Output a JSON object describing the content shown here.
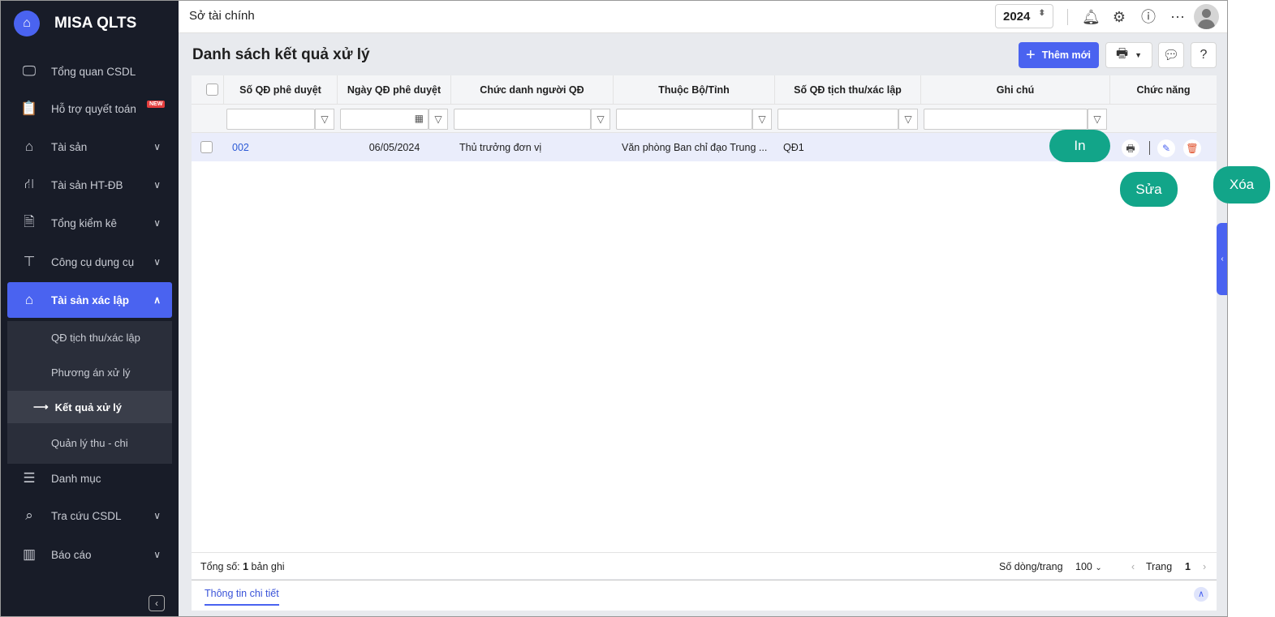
{
  "app": {
    "name": "MISA QLTS"
  },
  "sidebar": {
    "items": [
      {
        "label": "Tổng quan CSDL",
        "icon": "monitor-chart-icon"
      },
      {
        "label": "Hỗ trợ quyết toán",
        "icon": "clipboard-icon",
        "badge": "NEW"
      },
      {
        "label": "Tài sản",
        "icon": "house-car-icon"
      },
      {
        "label": "Tài sản HT-ĐB",
        "icon": "road-icon"
      },
      {
        "label": "Tổng kiểm kê",
        "icon": "document-check-icon"
      },
      {
        "label": "Công cụ dụng cụ",
        "icon": "paint-roller-icon"
      },
      {
        "label": "Tài sản xác lập",
        "icon": "house-car-icon"
      },
      {
        "label": "Danh mục",
        "icon": "list-icon"
      },
      {
        "label": "Tra cứu CSDL",
        "icon": "search-icon"
      },
      {
        "label": "Báo cáo",
        "icon": "report-chart-icon"
      }
    ],
    "subitems": [
      "QĐ tịch thu/xác lập",
      "Phương án xử lý",
      "Kết quả xử lý",
      "Quản lý thu - chi"
    ]
  },
  "header": {
    "title": "Sở tài chính",
    "year": "2024"
  },
  "page": {
    "title": "Danh sách kết quả xử lý",
    "add_label": "Thêm mới"
  },
  "table": {
    "columns": [
      "Số QĐ phê duyệt",
      "Ngày QĐ phê duyệt",
      "Chức danh người QĐ",
      "Thuộc Bộ/Tỉnh",
      "Số QĐ tịch thu/xác lập",
      "Ghi chú",
      "Chức năng"
    ],
    "rows": [
      {
        "so_qd": "002",
        "ngay": "06/05/2024",
        "chuc_danh": "Thủ trưởng đơn vị",
        "thuoc": "Văn phòng Ban chỉ đạo Trung ...",
        "so_qd_tt": "QĐ1",
        "ghi_chu": ""
      }
    ]
  },
  "callouts": {
    "print": "In",
    "edit": "Sửa",
    "delete": "Xóa"
  },
  "footer": {
    "total_prefix": "Tổng số: ",
    "total": "1",
    "total_suffix": " bản ghi",
    "rows_label": "Số dòng/trang",
    "rows_value": "100",
    "page_label": "Trang",
    "page": "1"
  },
  "bottom_panel": {
    "tab": "Thông tin chi tiết"
  },
  "colors": {
    "accent": "#4a63f0",
    "sidebar": "#181c28",
    "callout": "#12a589"
  }
}
